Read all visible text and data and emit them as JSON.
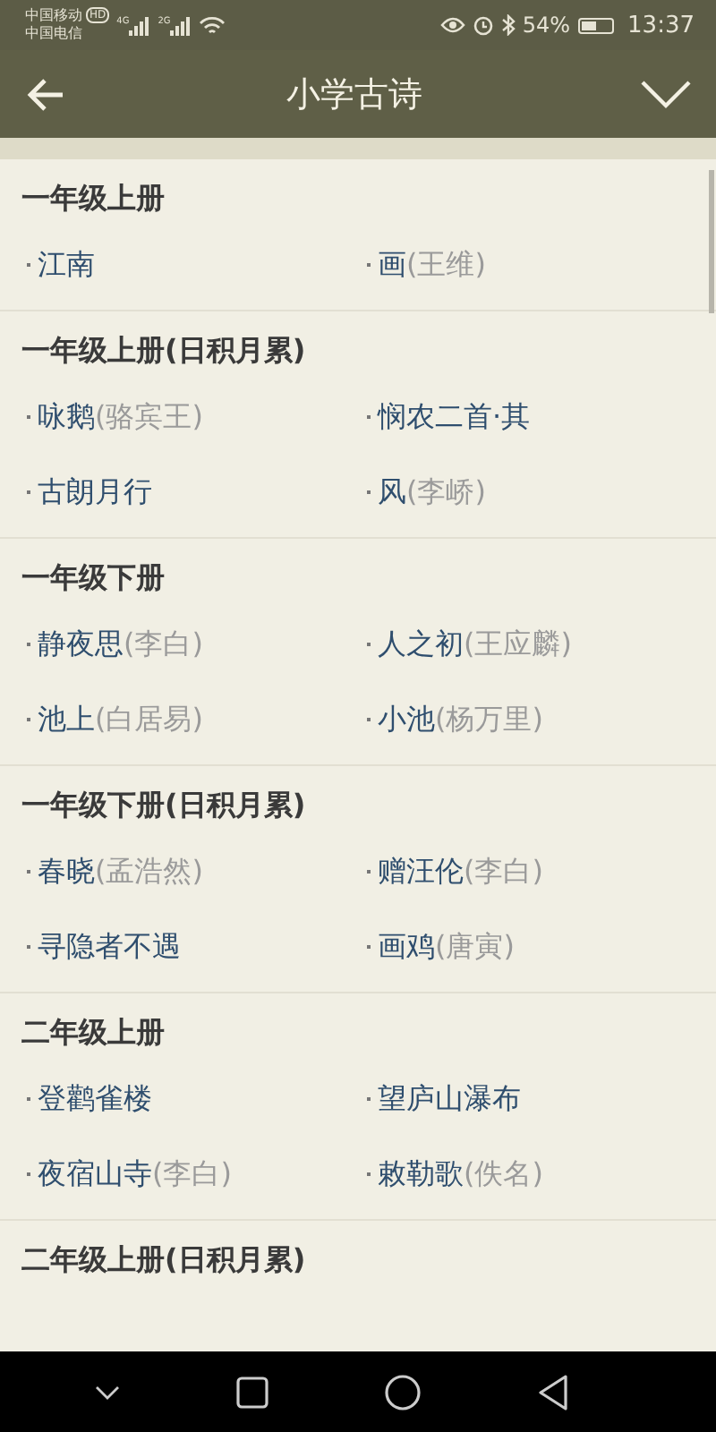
{
  "status_bar": {
    "carrier_1": "中国移动",
    "hd_badge": "HD",
    "network_1": "4G",
    "carrier_2": "中国电信",
    "network_2": "2G",
    "battery": "54%",
    "time": "13:37"
  },
  "app_bar": {
    "title": "小学古诗"
  },
  "sections": [
    {
      "title": "一年级上册",
      "items": [
        {
          "title": "江南"
        },
        {
          "title": "画",
          "author": "(王维)"
        }
      ]
    },
    {
      "title": "一年级上册(日积月累)",
      "items": [
        {
          "title": "咏鹅",
          "author": "(骆宾王)"
        },
        {
          "title": "悯农二首·其"
        },
        {
          "title": "古朗月行"
        },
        {
          "title": "风",
          "author": "(李峤)"
        }
      ]
    },
    {
      "title": "一年级下册",
      "items": [
        {
          "title": "静夜思",
          "author": "(李白)"
        },
        {
          "title": "人之初",
          "author": "(王应麟)"
        },
        {
          "title": "池上",
          "author": "(白居易)"
        },
        {
          "title": "小池",
          "author": "(杨万里)"
        }
      ]
    },
    {
      "title": "一年级下册(日积月累)",
      "items": [
        {
          "title": "春晓",
          "author": "(孟浩然)"
        },
        {
          "title": "赠汪伦",
          "author": "(李白)"
        },
        {
          "title": "寻隐者不遇"
        },
        {
          "title": "画鸡",
          "author": "(唐寅)"
        }
      ]
    },
    {
      "title": "二年级上册",
      "items": [
        {
          "title": "登鹳雀楼"
        },
        {
          "title": "望庐山瀑布"
        },
        {
          "title": "夜宿山寺",
          "author": "(李白)"
        },
        {
          "title": "敕勒歌",
          "author": "(佚名)"
        }
      ]
    },
    {
      "title": "二年级上册(日积月累)"
    }
  ]
}
